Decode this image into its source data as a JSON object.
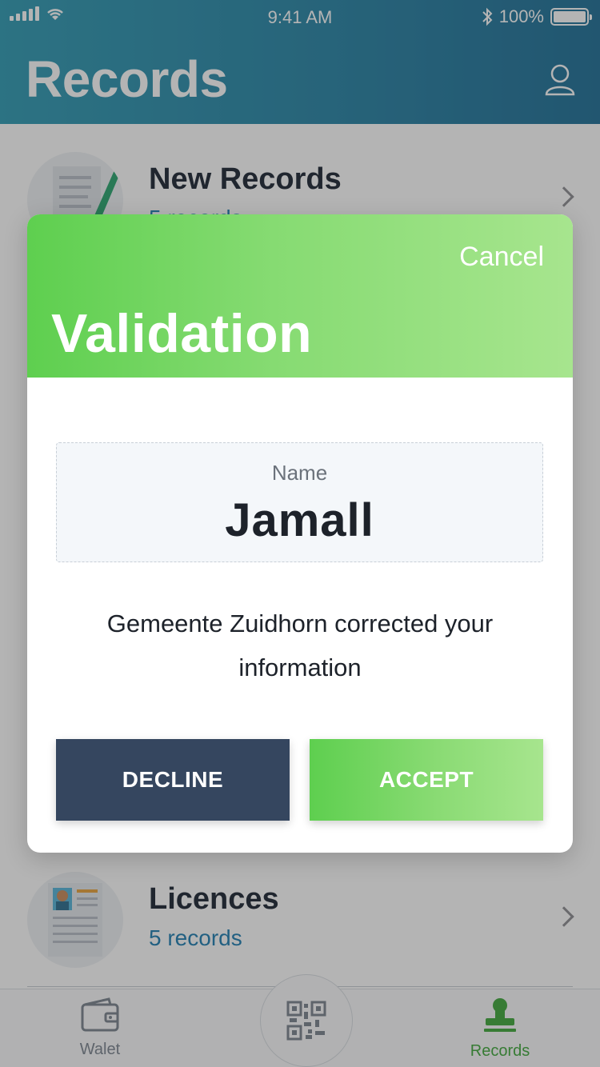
{
  "status_bar": {
    "time": "9:41 AM",
    "battery": "100%"
  },
  "header": {
    "title": "Records"
  },
  "list": {
    "items": [
      {
        "title": "New Records",
        "subtitle": "5 records"
      },
      {
        "title": "Licences",
        "subtitle": "5 records"
      }
    ]
  },
  "tab_bar": {
    "tabs": [
      {
        "label": "Walet",
        "active": false
      },
      {
        "label": "Records",
        "active": true
      }
    ],
    "active_color": "#3fa83b",
    "inactive_color": "#7b8490"
  },
  "modal": {
    "cancel_label": "Cancel",
    "title": "Validation",
    "field": {
      "label": "Name",
      "value": "Jamall"
    },
    "message": "Gemeente Zuidhorn corrected your information",
    "decline_label": "DECLINE",
    "accept_label": "ACCEPT"
  },
  "colors": {
    "header_gradient_start": "#2f9bb4",
    "header_gradient_end": "#1f6f97",
    "accept_green": "#5ecf4f",
    "decline_navy": "#35465f",
    "link_blue": "#1f7fb3"
  }
}
